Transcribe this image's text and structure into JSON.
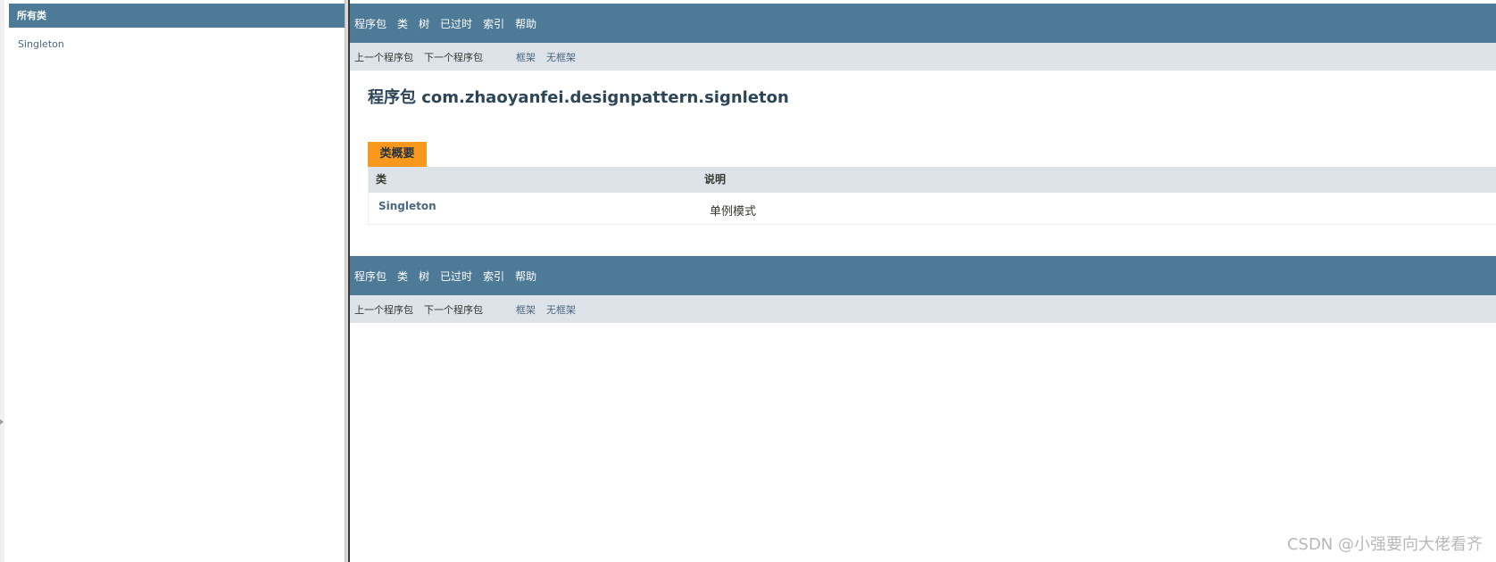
{
  "left": {
    "header": "所有类",
    "items": [
      {
        "label": "Singleton"
      }
    ]
  },
  "top_nav": {
    "links": [
      "程序包",
      "类",
      "树",
      "已过时",
      "索引",
      "帮助"
    ]
  },
  "sub_nav": {
    "prev_package": "上一个程序包",
    "next_package": "下一个程序包",
    "frames": "框架",
    "no_frames": "无框架"
  },
  "main": {
    "title": "程序包 com.zhaoyanfei.designpattern.signleton",
    "summary_tab": "类概要",
    "table": {
      "headers": [
        "类",
        "说明"
      ],
      "rows": [
        {
          "class": "Singleton",
          "description": "单例模式"
        }
      ]
    }
  },
  "watermark": "CSDN @小强要向大佬看齐",
  "colors": {
    "nav_bar": "#4d7a97",
    "sub_nav": "#dee3e9",
    "tab_accent": "#f8981d",
    "link": "#4a6782"
  }
}
